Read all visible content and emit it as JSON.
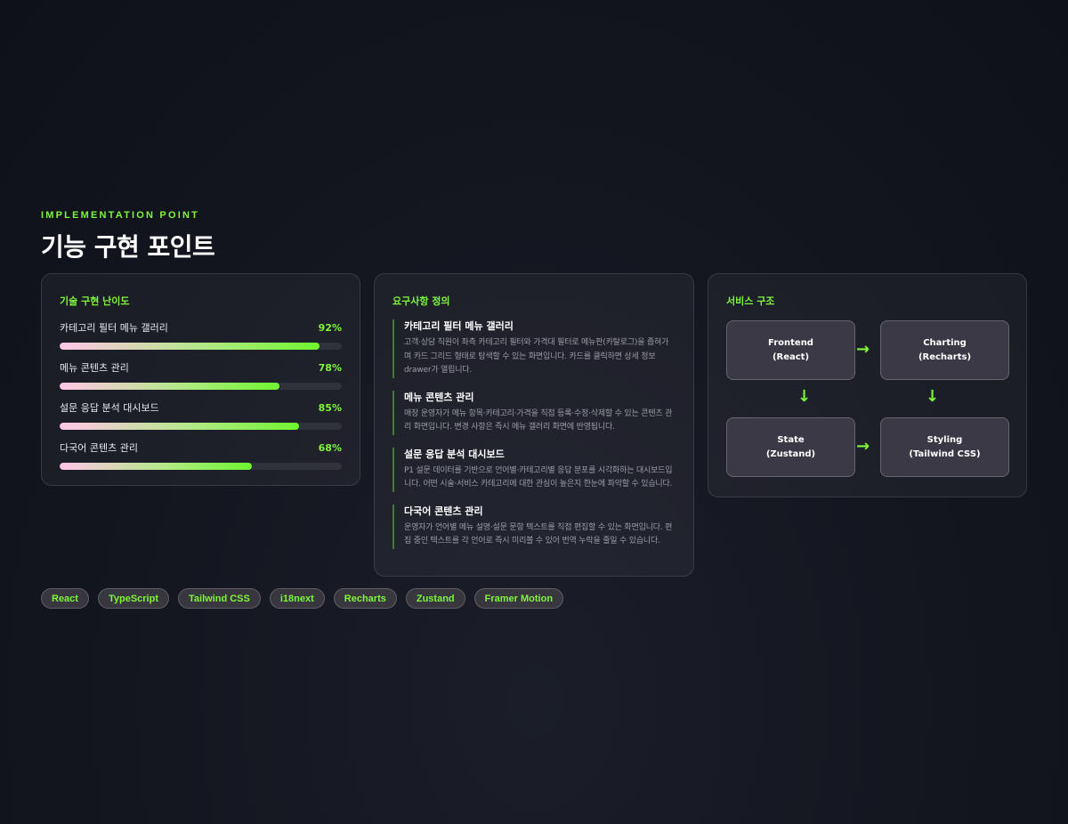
{
  "header": {
    "tag": "IMPLEMENTATION POINT",
    "title": "기능 구현 포인트"
  },
  "difficulty": {
    "title": "기술 구현 난이도",
    "items": [
      {
        "name": "카테고리 필터 메뉴 갤러리",
        "percent_label": "92%",
        "value": 0.92
      },
      {
        "name": "메뉴 콘텐츠 관리",
        "percent_label": "78%",
        "value": 0.78
      },
      {
        "name": "설문 응답 분석 대시보드",
        "percent_label": "85%",
        "value": 0.85
      },
      {
        "name": "다국어 콘텐츠 관리",
        "percent_label": "68%",
        "value": 0.68
      }
    ]
  },
  "requirements": {
    "title": "요구사항 정의",
    "items": [
      {
        "title": "카테고리 필터 메뉴 갤러리",
        "desc": "고객·상담 직원이 좌측 카테고리 필터와 가격대 필터로 메뉴판(카탈로그)을 좁혀가며 카드 그리드 형태로 탐색할 수 있는 화면입니다. 카드를 클릭하면 상세 정보 drawer가 열립니다."
      },
      {
        "title": "메뉴 콘텐츠 관리",
        "desc": "매장 운영자가 메뉴 항목·카테고리·가격을 직접 등록·수정·삭제할 수 있는 콘텐츠 관리 화면입니다. 변경 사항은 즉시 메뉴 갤러리 화면에 반영됩니다."
      },
      {
        "title": "설문 응답 분석 대시보드",
        "desc": "P1 설문 데이터를 기반으로 언어별·카테고리별 응답 분포를 시각화하는 대시보드입니다. 어떤 시술·서비스 카테고리에 대한 관심이 높은지 한눈에 파악할 수 있습니다."
      },
      {
        "title": "다국어 콘텐츠 관리",
        "desc": "운영자가 언어별 메뉴 설명·설문 문항 텍스트를 직접 편집할 수 있는 화면입니다. 편집 중인 텍스트를 각 언어로 즉시 미리볼 수 있어 번역 누락을 줄일 수 있습니다."
      }
    ]
  },
  "architecture": {
    "title": "서비스 구조",
    "nodes": [
      {
        "name": "Frontend",
        "sub": "(React)"
      },
      {
        "name": "Charting",
        "sub": "(Recharts)"
      },
      {
        "name": "State",
        "sub": "(Zustand)"
      },
      {
        "name": "Styling",
        "sub": "(Tailwind CSS)"
      }
    ],
    "arrows": [
      "→",
      "↓",
      "↓",
      "→"
    ]
  },
  "tech_tags": [
    "React",
    "TypeScript",
    "Tailwind CSS",
    "i18next",
    "Recharts",
    "Zustand",
    "Framer Motion"
  ],
  "colors": {
    "accent": "#7ef53a",
    "background": "#13151f",
    "card": "#1c1e28",
    "node": "#3b3945"
  }
}
